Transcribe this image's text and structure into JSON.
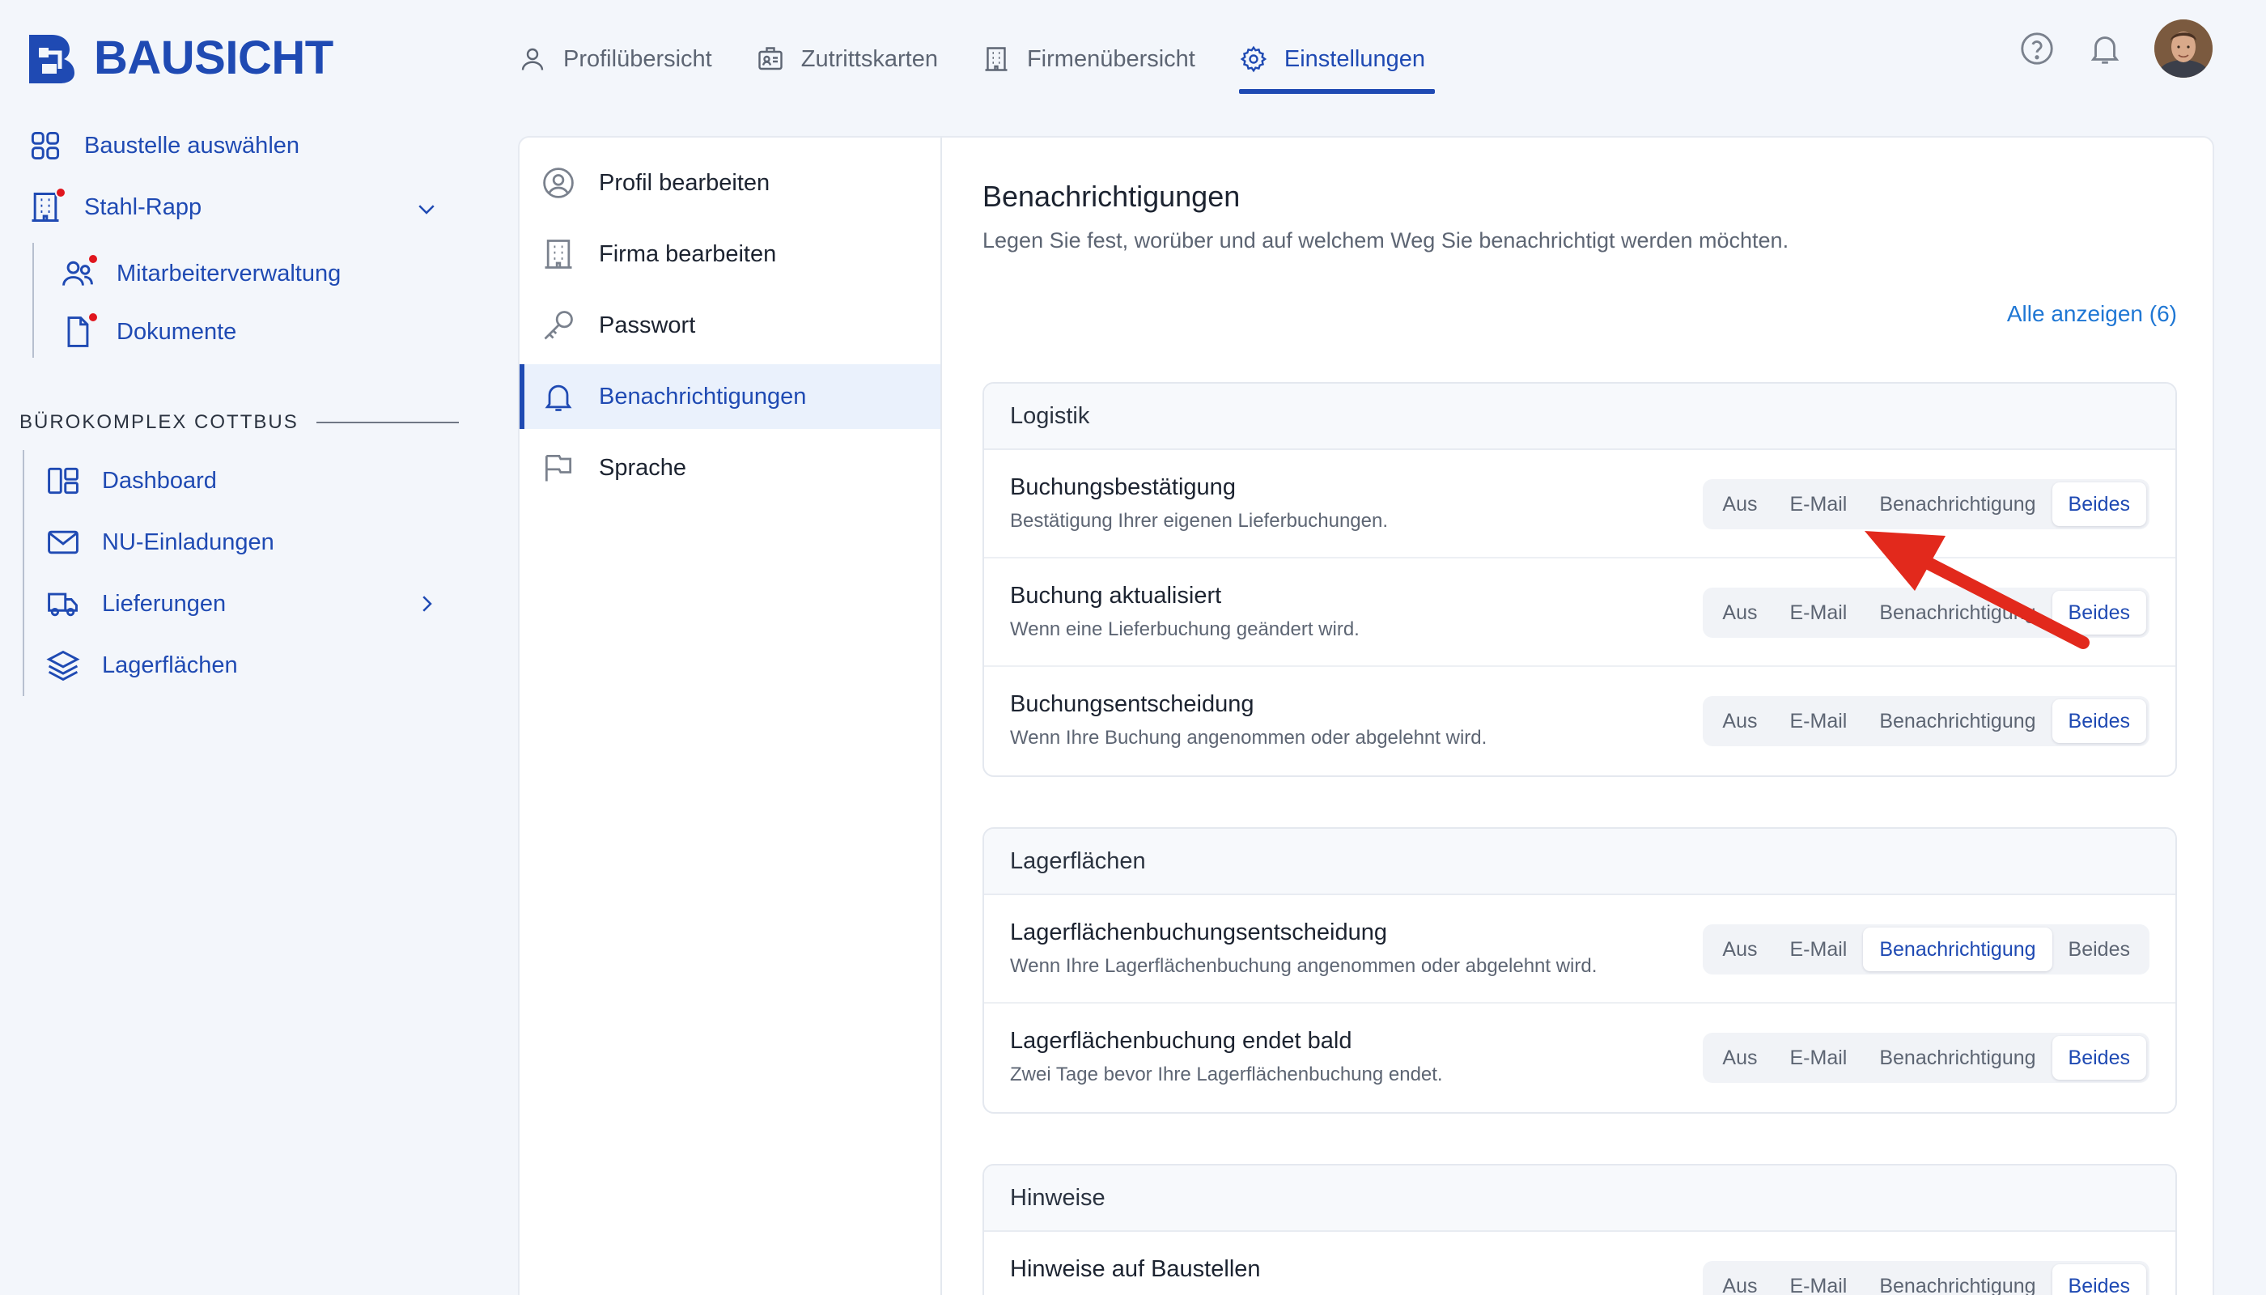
{
  "brand": {
    "name": "BAUSICHT",
    "color": "#1f4ab3"
  },
  "topnav": {
    "tabs": [
      {
        "label": "Profilübersicht",
        "icon": "user-icon",
        "active": false
      },
      {
        "label": "Zutrittskarten",
        "icon": "id-card-icon",
        "active": false
      },
      {
        "label": "Firmenübersicht",
        "icon": "building-icon",
        "active": false
      },
      {
        "label": "Einstellungen",
        "icon": "gear-icon",
        "active": true
      }
    ],
    "right_icons": [
      "help-icon",
      "bell-icon",
      "avatar"
    ]
  },
  "sidebar": {
    "select_site": "Baustelle auswählen",
    "company": "Stahl-Rapp",
    "company_items": [
      {
        "label": "Mitarbeiterverwaltung",
        "icon": "users-icon",
        "badge": true
      },
      {
        "label": "Dokumente",
        "icon": "document-icon",
        "badge": true
      }
    ],
    "section_heading": "BÜROKOMPLEX COTTBUS",
    "section_items": [
      {
        "label": "Dashboard",
        "icon": "dashboard-icon"
      },
      {
        "label": "NU-Einladungen",
        "icon": "mail-icon"
      },
      {
        "label": "Lieferungen",
        "icon": "truck-icon"
      },
      {
        "label": "Lagerflächen",
        "icon": "layers-icon"
      }
    ]
  },
  "settings_menu": [
    {
      "label": "Profil bearbeiten",
      "icon": "user-circle-icon",
      "active": false
    },
    {
      "label": "Firma bearbeiten",
      "icon": "building-icon",
      "active": false
    },
    {
      "label": "Passwort",
      "icon": "key-icon",
      "active": false
    },
    {
      "label": "Benachrichtigungen",
      "icon": "bell-icon",
      "active": true
    },
    {
      "label": "Sprache",
      "icon": "flag-icon",
      "active": false
    }
  ],
  "content": {
    "title": "Benachrichtigungen",
    "subtitle": "Legen Sie fest, worüber und auf welchem Weg Sie benachrichtigt werden möchten.",
    "show_all": "Alle anzeigen (6)",
    "options": [
      "Aus",
      "E-Mail",
      "Benachrichtigung",
      "Beides"
    ],
    "groups": [
      {
        "title": "Logistik",
        "rows": [
          {
            "title": "Buchungsbestätigung",
            "desc": "Bestätigung Ihrer eigenen Lieferbuchungen.",
            "selected": "Beides"
          },
          {
            "title": "Buchung aktualisiert",
            "desc": "Wenn eine Lieferbuchung geändert wird.",
            "selected": "Beides"
          },
          {
            "title": "Buchungsentscheidung",
            "desc": "Wenn Ihre Buchung angenommen oder abgelehnt wird.",
            "selected": "Beides"
          }
        ]
      },
      {
        "title": "Lagerflächen",
        "rows": [
          {
            "title": "Lagerflächenbuchungsentscheidung",
            "desc": "Wenn Ihre Lagerflächenbuchung angenommen oder abgelehnt wird.",
            "selected": "Benachrichtigung"
          },
          {
            "title": "Lagerflächenbuchung endet bald",
            "desc": "Zwei Tage bevor Ihre Lagerflächenbuchung endet.",
            "selected": "Beides"
          }
        ]
      },
      {
        "title": "Hinweise",
        "rows": [
          {
            "title": "Hinweise auf Baustellen",
            "desc": "",
            "selected": "Beides"
          }
        ]
      }
    ]
  },
  "colors": {
    "accent": "#1f4ab3",
    "link": "#1f77d4",
    "badge": "#e0161e",
    "annotation_arrow": "#e2291c"
  }
}
